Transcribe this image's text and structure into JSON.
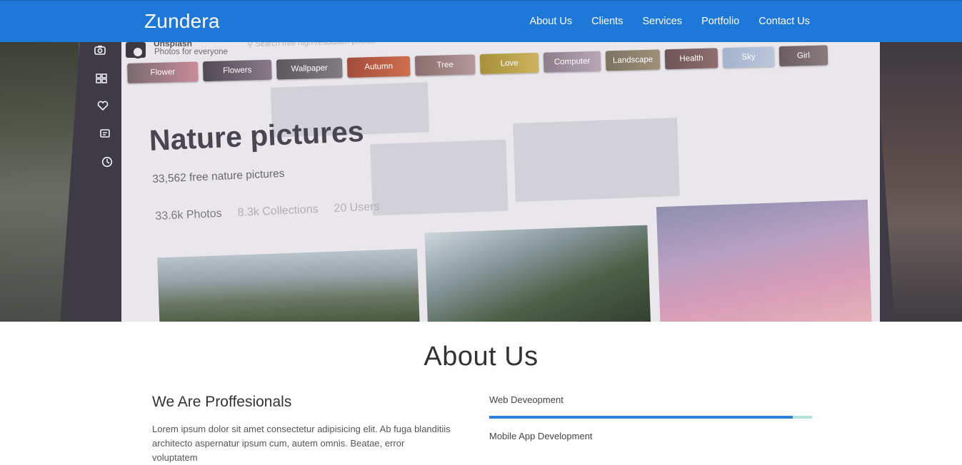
{
  "navbar": {
    "brand": "Zundera",
    "links": [
      "About Us",
      "Clients",
      "Services",
      "Portfolio",
      "Contact Us"
    ],
    "background_color": "#1e78d7"
  },
  "hero": {
    "app_name": "Unsplash",
    "tagline": "Photos for everyone",
    "search_placeholder": "Search free high-resolution photos",
    "side_icons": [
      "camera-icon",
      "grid-icon",
      "heart-icon",
      "collection-icon",
      "clock-icon"
    ],
    "chips": [
      "Flower",
      "Flowers",
      "Wallpaper",
      "Autumn",
      "Tree",
      "Love",
      "Computer",
      "Landscape",
      "Health",
      "Sky",
      "Girl"
    ],
    "page_title": "Nature pictures",
    "count_text": "33,562 free nature pictures",
    "stats": [
      "33.6k Photos",
      "8.3k Collections",
      "20 Users"
    ]
  },
  "about": {
    "title": "About Us",
    "heading": "We Are Proffesionals",
    "paragraph": "Lorem ipsum dolor sit amet consectetur adipisicing elit. Ab fuga blanditiis architecto aspernatur ipsum cum, autem omnis. Beatae, error voluptatem",
    "skills": [
      {
        "label": "Web Deveopment",
        "level": 0.94
      },
      {
        "label": "Mobile App Development",
        "level": null
      }
    ],
    "accent_color": "#2a82dd",
    "track_color": "#b3e3da"
  }
}
